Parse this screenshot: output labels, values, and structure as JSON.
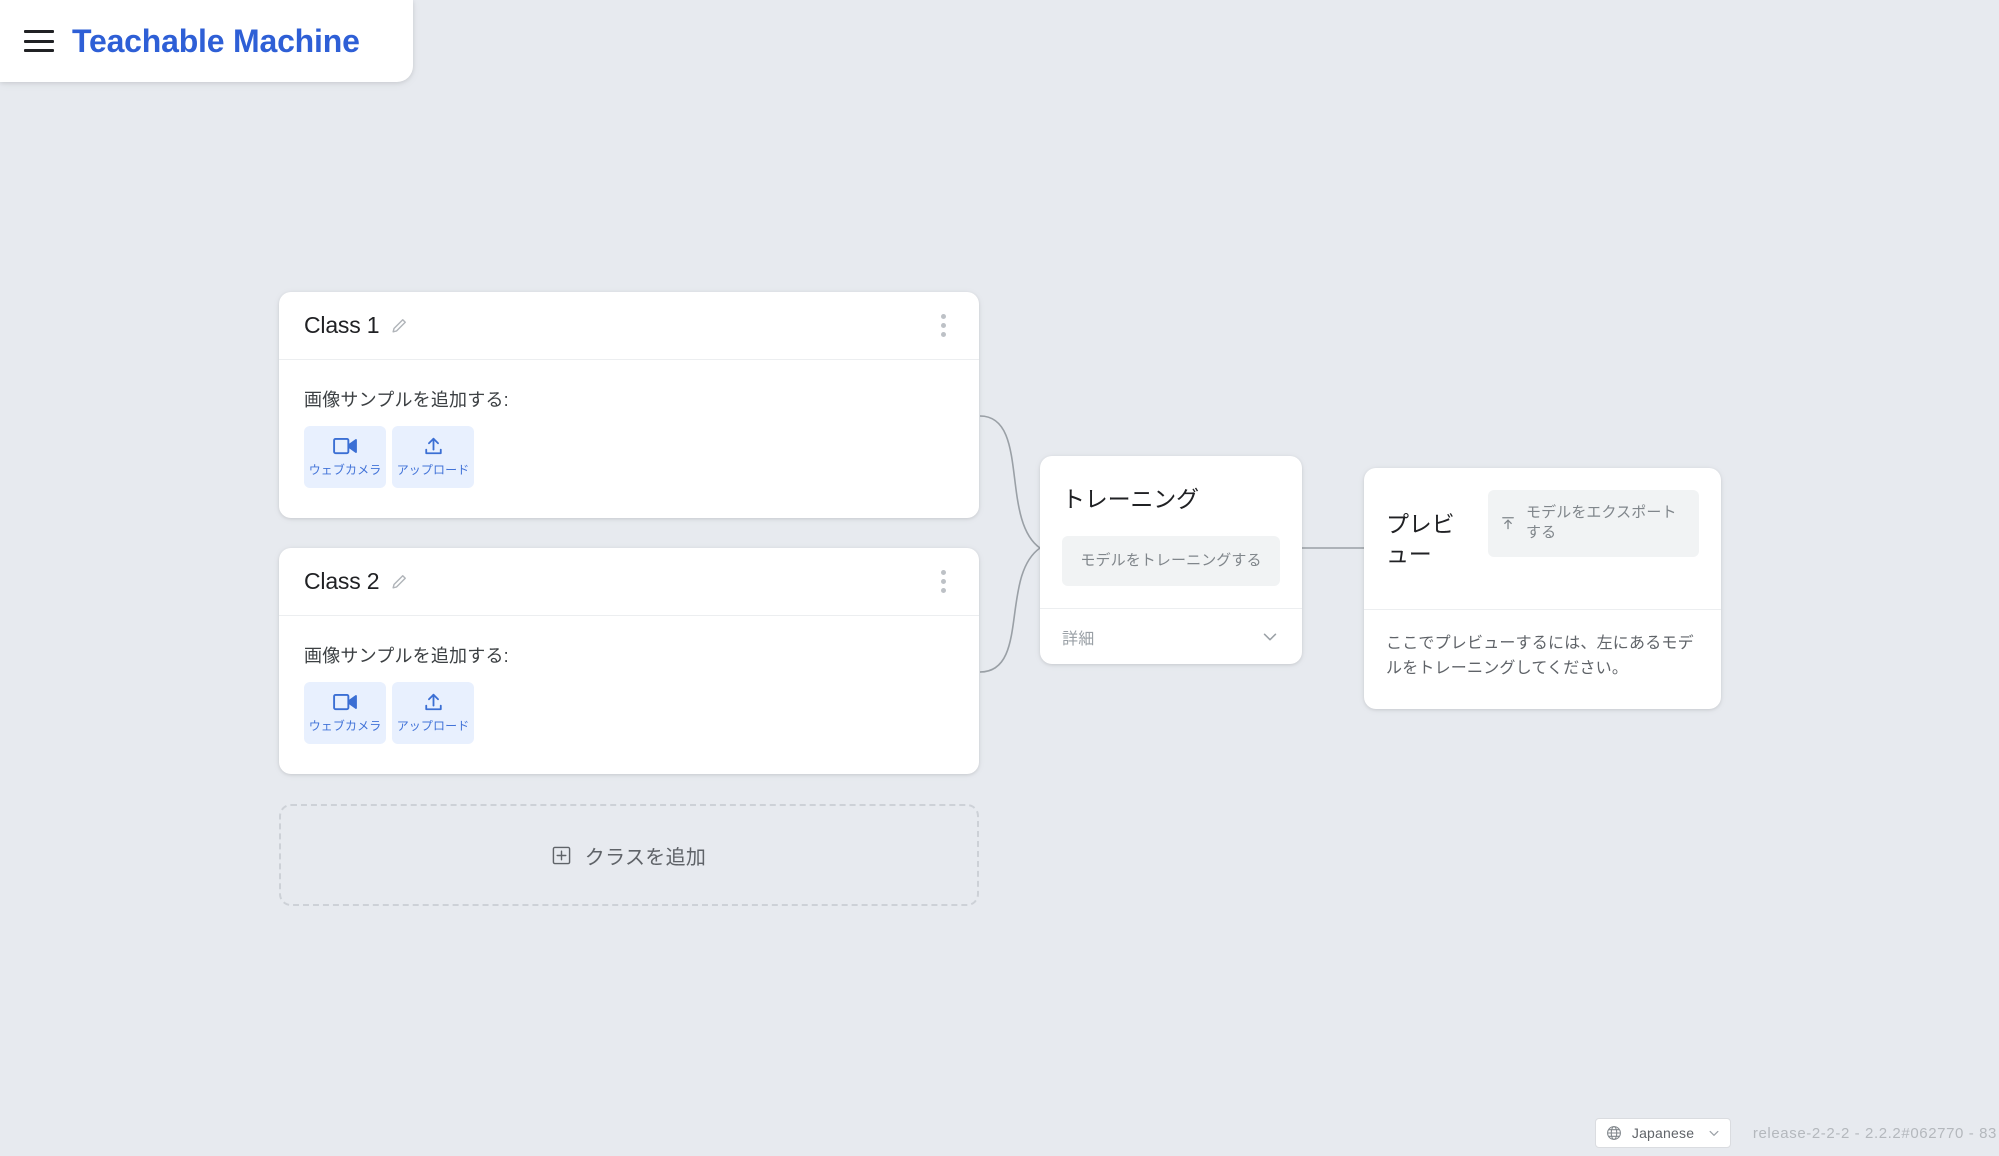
{
  "header": {
    "menu_icon": "hamburger-menu-icon",
    "brand_title": "Teachable Machine",
    "brand_color": "#2e5fd6"
  },
  "classes": [
    {
      "title": "Class 1",
      "edit_icon": "pencil-icon",
      "menu_icon": "kebab-menu-icon",
      "add_samples_label": "画像サンプルを追加する:",
      "buttons": [
        {
          "label": "ウェブカメラ",
          "icon": "webcam-icon"
        },
        {
          "label": "アップロード",
          "icon": "upload-icon"
        }
      ]
    },
    {
      "title": "Class 2",
      "edit_icon": "pencil-icon",
      "menu_icon": "kebab-menu-icon",
      "add_samples_label": "画像サンプルを追加する:",
      "buttons": [
        {
          "label": "ウェブカメラ",
          "icon": "webcam-icon"
        },
        {
          "label": "アップロード",
          "icon": "upload-icon"
        }
      ]
    }
  ],
  "add_class": {
    "label": "クラスを追加",
    "icon": "add-box-icon"
  },
  "training": {
    "heading": "トレーニング",
    "train_button_label": "モデルをトレーニングする",
    "advanced_label": "詳細",
    "advanced_icon": "chevron-down-icon"
  },
  "preview": {
    "heading": "プレビュー",
    "export_button_label": "モデルをエクスポートする",
    "export_icon": "export-upload-icon",
    "hint": "ここでプレビューするには、左にあるモデルをトレーニングしてください。"
  },
  "footer": {
    "language_icon": "globe-icon",
    "language_value": "Japanese",
    "language_chevron": "chevron-down-icon",
    "version": "release-2-2-2 - 2.2.2#062770 - 83"
  },
  "theme": {
    "background": "#e7eaef",
    "card_background": "#ffffff",
    "accent_blue": "#2e5fd6",
    "button_blue_bg": "#e8f0fe",
    "button_blue_text": "#4273d8",
    "muted_button_bg": "#f1f3f4",
    "muted_text": "#80868b",
    "connector_stroke": "#9aa0a6"
  }
}
